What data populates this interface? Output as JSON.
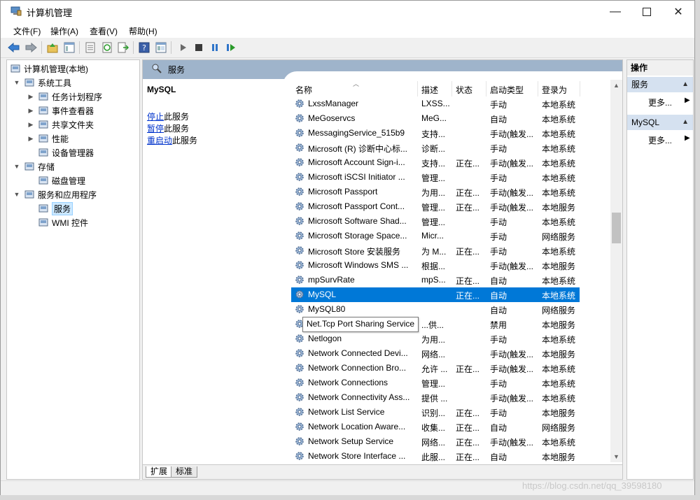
{
  "window": {
    "title": "计算机管理"
  },
  "menu": [
    "文件(F)",
    "操作(A)",
    "查看(V)",
    "帮助(H)"
  ],
  "tree": [
    {
      "label": "计算机管理(本地)",
      "level": 0,
      "arrow": "",
      "icon": "computer-management-icon"
    },
    {
      "label": "系统工具",
      "level": 1,
      "arrow": "▼",
      "icon": "system-tools-icon"
    },
    {
      "label": "任务计划程序",
      "level": 2,
      "arrow": "▶",
      "icon": "task-scheduler-icon"
    },
    {
      "label": "事件查看器",
      "level": 2,
      "arrow": "▶",
      "icon": "event-viewer-icon"
    },
    {
      "label": "共享文件夹",
      "level": 2,
      "arrow": "▶",
      "icon": "shared-folders-icon"
    },
    {
      "label": "性能",
      "level": 2,
      "arrow": "▶",
      "icon": "performance-icon"
    },
    {
      "label": "设备管理器",
      "level": 2,
      "arrow": "",
      "icon": "device-manager-icon"
    },
    {
      "label": "存储",
      "level": 1,
      "arrow": "▼",
      "icon": "storage-icon"
    },
    {
      "label": "磁盘管理",
      "level": 2,
      "arrow": "",
      "icon": "disk-management-icon"
    },
    {
      "label": "服务和应用程序",
      "level": 1,
      "arrow": "▼",
      "icon": "services-apps-icon"
    },
    {
      "label": "服务",
      "level": 2,
      "arrow": "",
      "icon": "services-icon",
      "selected": true
    },
    {
      "label": "WMI 控件",
      "level": 2,
      "arrow": "",
      "icon": "wmi-icon"
    }
  ],
  "center": {
    "header": "服务",
    "selected_service": "MySQL",
    "links": [
      {
        "link": "停止",
        "rest": "此服务"
      },
      {
        "link": "暂停",
        "rest": "此服务"
      },
      {
        "link": "重启动",
        "rest": "此服务"
      }
    ],
    "columns": [
      "名称",
      "描述",
      "状态",
      "启动类型",
      "登录为"
    ],
    "services": [
      [
        "LxssManager",
        "LXSS...",
        "",
        "手动",
        "本地系统"
      ],
      [
        "MeGoservcs",
        "MeG...",
        "",
        "自动",
        "本地系统"
      ],
      [
        "MessagingService_515b9",
        "支持...",
        "",
        "手动(触发...",
        "本地系统"
      ],
      [
        "Microsoft (R) 诊断中心标...",
        "诊断...",
        "",
        "手动",
        "本地系统"
      ],
      [
        "Microsoft Account Sign-i...",
        "支持...",
        "正在...",
        "手动(触发...",
        "本地系统"
      ],
      [
        "Microsoft iSCSI Initiator ...",
        "管理...",
        "",
        "手动",
        "本地系统"
      ],
      [
        "Microsoft Passport",
        "为用...",
        "正在...",
        "手动(触发...",
        "本地系统"
      ],
      [
        "Microsoft Passport Cont...",
        "管理...",
        "正在...",
        "手动(触发...",
        "本地服务"
      ],
      [
        "Microsoft Software Shad...",
        "管理...",
        "",
        "手动",
        "本地系统"
      ],
      [
        "Microsoft Storage Space...",
        "Micr...",
        "",
        "手动",
        "网络服务"
      ],
      [
        "Microsoft Store 安装服务",
        "为 M...",
        "正在...",
        "手动",
        "本地系统"
      ],
      [
        "Microsoft Windows SMS ...",
        "根据...",
        "",
        "手动(触发...",
        "本地服务"
      ],
      [
        "mpSurvRate",
        "mpS...",
        "正在...",
        "自动",
        "本地系统"
      ],
      [
        "MySQL",
        "",
        "正在...",
        "自动",
        "本地系统"
      ],
      [
        "MySQL80",
        "",
        "",
        "自动",
        "网络服务"
      ],
      [
        "",
        "...供...",
        "",
        "禁用",
        "本地服务"
      ],
      [
        "Netlogon",
        "为用...",
        "",
        "手动",
        "本地系统"
      ],
      [
        "Network Connected Devi...",
        "网络...",
        "",
        "手动(触发...",
        "本地服务"
      ],
      [
        "Network Connection Bro...",
        "允许 ...",
        "正在...",
        "手动(触发...",
        "本地系统"
      ],
      [
        "Network Connections",
        "管理...",
        "",
        "手动",
        "本地系统"
      ],
      [
        "Network Connectivity Ass...",
        "提供 ...",
        "",
        "手动(触发...",
        "本地系统"
      ],
      [
        "Network List Service",
        "识别...",
        "正在...",
        "手动",
        "本地服务"
      ],
      [
        "Network Location Aware...",
        "收集...",
        "正在...",
        "自动",
        "网络服务"
      ],
      [
        "Network Setup Service",
        "网络...",
        "正在...",
        "手动(触发...",
        "本地系统"
      ],
      [
        "Network Store Interface ...",
        "此服...",
        "正在...",
        "自动",
        "本地服务"
      ]
    ],
    "selected_index": 13,
    "tooltip": "Net.Tcp Port Sharing Service",
    "tabs": [
      "扩展",
      "标准"
    ]
  },
  "actions": {
    "title": "操作",
    "sections": [
      {
        "label": "服务",
        "more": "更多..."
      },
      {
        "label": "MySQL",
        "more": "更多..."
      }
    ]
  },
  "watermark": "https://blog.csdn.net/qq_39598180",
  "colors": {
    "selection": "#0078d7",
    "header": "#9fb4cb",
    "action_section": "#d5e1f0"
  }
}
